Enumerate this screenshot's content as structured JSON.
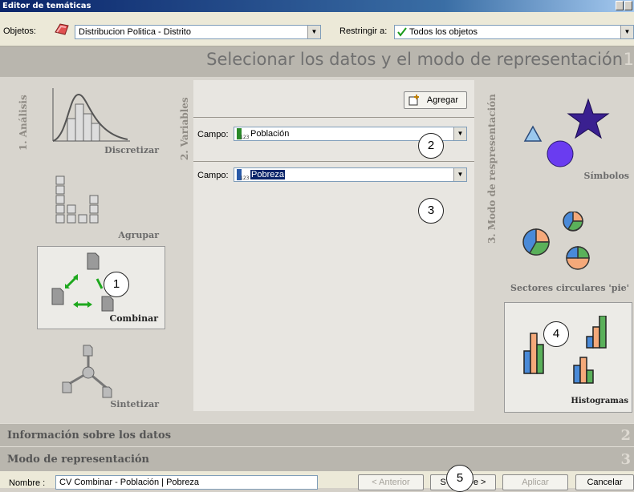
{
  "window": {
    "title": "Editor de temáticas"
  },
  "toolbar": {
    "objetos_label": "Objetos:",
    "objetos_value": "Distribucion Politica - Distrito",
    "restringir_label": "Restringir a:",
    "restringir_value": "Todos los objetos"
  },
  "heading": {
    "title": "Selecionar los datos y el modo de representación",
    "step": "1"
  },
  "analysis": {
    "section_label": "1. Análisis",
    "tools": [
      {
        "label": "Discretizar"
      },
      {
        "label": "Agrupar"
      },
      {
        "label": "Combinar"
      },
      {
        "label": "Sintetizar"
      }
    ]
  },
  "variables": {
    "section_label": "2. Variables",
    "add_button": "Agregar",
    "fields": [
      {
        "label": "Campo:",
        "value": "Población"
      },
      {
        "label": "Campo:",
        "value": "Pobreza"
      }
    ]
  },
  "representation": {
    "section_label": "3. Modo de respresentación",
    "modes": [
      {
        "label": "Símbolos"
      },
      {
        "label": "Sectores circulares 'pie'"
      },
      {
        "label": "Histogramas"
      }
    ]
  },
  "annotations": [
    "1",
    "2",
    "3",
    "4",
    "5"
  ],
  "sections": {
    "info": "Información sobre los datos",
    "modo": "Modo de representación",
    "chev": "2",
    "chev2": "3"
  },
  "footer": {
    "nombre_label": "Nombre :",
    "nombre_value": "CV Combinar - Población | Pobreza",
    "anterior": "< Anterior",
    "siguiente": "Siguiente >",
    "siguiente_visible": "S",
    "siguiente_tail": "e >",
    "aplicar": "Aplicar",
    "cancelar": "Cancelar"
  },
  "colors": {
    "accent": "#0a246a",
    "panel": "#d8d5ce",
    "heading": "#b9b6ae"
  }
}
